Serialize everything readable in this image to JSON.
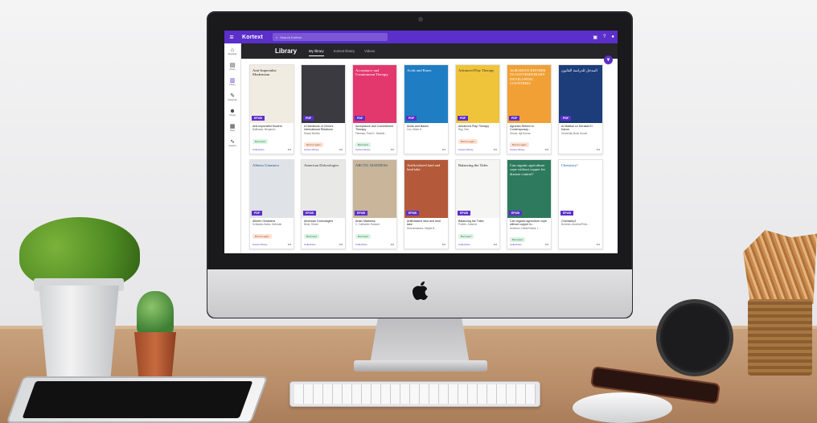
{
  "app": {
    "brand": "Kortext",
    "search_placeholder": "Search Kortext",
    "page_title": "Library",
    "tabs": [
      {
        "label": "My library",
        "active": true
      },
      {
        "label": "Kortext library",
        "active": false
      },
      {
        "label": "Videos",
        "active": false
      }
    ],
    "sidebar": [
      {
        "label": "Bookshelf",
        "icon": "bookshelf-icon"
      },
      {
        "label": "Library",
        "icon": "book-icon"
      },
      {
        "label": "Library",
        "icon": "library-icon",
        "active": true
      },
      {
        "label": "Notebooks",
        "icon": "notebook-icon"
      },
      {
        "label": "Groups",
        "icon": "groups-icon"
      },
      {
        "label": "Notes",
        "icon": "notes-icon"
      },
      {
        "label": "Analytics",
        "icon": "analytics-icon"
      }
    ],
    "accent_color": "#5b2fc9",
    "books": [
      {
        "title": "Anti-Imperialist Modern",
        "author": "Balthaser, Benjamin",
        "format": "EPUB",
        "status": "Borrowed",
        "source": "Collections",
        "cover_title": "Anti-Imperialist Modernism",
        "cover_bg": "#f1ece2",
        "cover_fg": "#222222"
      },
      {
        "title": "A Handbook of China's International Relations",
        "author": "Shaun Breslin",
        "format": "PDF",
        "status": "Borrow again",
        "source": "Kortext library",
        "cover_title": "",
        "cover_bg": "#3a3a40",
        "cover_fg": "#ffffff"
      },
      {
        "title": "Acceptance and Commitment Therapy",
        "author": "Flaxman, Paul E.; Blackle...",
        "format": "PDF",
        "status": "Borrowed",
        "source": "Kortext library",
        "cover_title": "Acceptance and Commitment Therapy",
        "cover_bg": "#e3386e",
        "cover_fg": "#ffffff"
      },
      {
        "title": "Acids and Bases",
        "author": "Cox, Brian G.",
        "format": "PDF",
        "status": "",
        "source": "",
        "cover_title": "Acids and Bases",
        "cover_bg": "#1f7dc4",
        "cover_fg": "#ffffff"
      },
      {
        "title": "Advanced Play Therapy",
        "author": "Ray, Dee",
        "format": "PDF",
        "status": "Borrow again",
        "source": "Kortext library",
        "cover_title": "Advanced Play Therapy",
        "cover_bg": "#f0c43a",
        "cover_fg": "#333333"
      },
      {
        "title": "Agrarian Reform in Contemporary...",
        "author": "Ghose, Ajit Kumar",
        "format": "PDF",
        "status": "Borrow again",
        "source": "Kortext library",
        "cover_title": "AGRARIAN REFORM IN CONTEMPORARY DEVELOPING COUNTRIES",
        "cover_bg": "#f0a035",
        "cover_fg": "#ffffff"
      },
      {
        "title": "Al Madkal Le Derasat El Kanon",
        "author": "University Book House",
        "format": "PDF",
        "status": "",
        "source": "",
        "cover_title": "المدخل للدراسة القانون",
        "cover_bg": "#1d3d7a",
        "cover_fg": "#ffffff"
      },
      {
        "title": "Alberto Ginastera",
        "author": "Schwartz-Kates, Deborah",
        "format": "PDF",
        "status": "Borrow again",
        "source": "Kortext library",
        "cover_title": "Alberto Ginastera",
        "cover_bg": "#dfe3e8",
        "cover_fg": "#2a4d86"
      },
      {
        "title": "American Dolorologies",
        "author": "Brink, Simon",
        "format": "EPUB",
        "status": "Borrowed",
        "source": "Collections",
        "cover_title": "American Dolorologies",
        "cover_bg": "#e8e8e6",
        "cover_fg": "#333333"
      },
      {
        "title": "Arctic Madness",
        "author": "C. Catharine Howard",
        "format": "EPUB",
        "status": "Borrowed",
        "source": "Collections",
        "cover_title": "ARCTIC MADNESS",
        "cover_bg": "#c9b59a",
        "cover_fg": "#1f4a7a"
      },
      {
        "title": "Artificialized land and land take",
        "author": "Desrousseaux, Maylis B...",
        "format": "EPUB",
        "status": "",
        "source": "",
        "cover_title": "Artificialized land and land take",
        "cover_bg": "#b45a3a",
        "cover_fg": "#ffffff"
      },
      {
        "title": "Balancing the Tides",
        "author": "Pollete, Jolanna",
        "format": "EPUB",
        "status": "Borrowed",
        "source": "Collections",
        "cover_title": "Balancing the Tides",
        "cover_bg": "#f5f5f3",
        "cover_fg": "#222222"
      },
      {
        "title": "Can organic agriculture cope without copper fo...",
        "author": "Andrivon, Didier/Savini, I...",
        "format": "EPUB",
        "status": "Borrowed",
        "source": "Collections",
        "cover_title": "Can organic agriculture cope without copper for disease control?",
        "cover_bg": "#2d7a5e",
        "cover_fg": "#ffffff"
      },
      {
        "title": "Chemistry3",
        "author": "Burrows, Andrew/Prick...",
        "format": "EPUB",
        "status": "",
        "source": "",
        "cover_title": "Chemistry³",
        "cover_bg": "#ffffff",
        "cover_fg": "#1a5aa8"
      }
    ]
  }
}
